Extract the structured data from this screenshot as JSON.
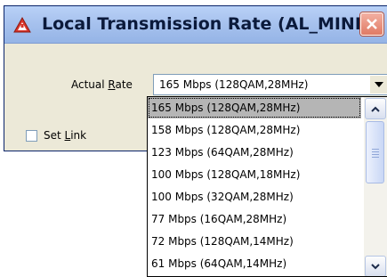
{
  "window": {
    "title": "Local Transmission Rate (AL_MINI)",
    "icon": "warning-triangle-icon",
    "close_icon": "close-icon"
  },
  "rate": {
    "label_prefix": "Actual ",
    "label_accel": "R",
    "label_suffix": "ate",
    "selected_value": "165 Mbps (128QAM,28MHz)"
  },
  "set_link": {
    "label_prefix": "Set ",
    "label_accel": "L",
    "label_suffix": "ink",
    "checked": false
  },
  "dropdown": {
    "options": [
      "165 Mbps (128QAM,28MHz)",
      "158 Mbps (128QAM,28MHz)",
      "123 Mbps (64QAM,28MHz)",
      "100 Mbps (128QAM,18MHz)",
      "100 Mbps (32QAM,28MHz)",
      "77 Mbps (16QAM,28MHz)",
      "72 Mbps (128QAM,14MHz)",
      "61 Mbps (64QAM,14MHz)"
    ],
    "selected_index": 0
  },
  "colors": {
    "title_bar": "#a7c2ee",
    "close_button": "#e07a64",
    "dialog_bg": "#ece9d8",
    "selection": "#b5b5b5"
  }
}
